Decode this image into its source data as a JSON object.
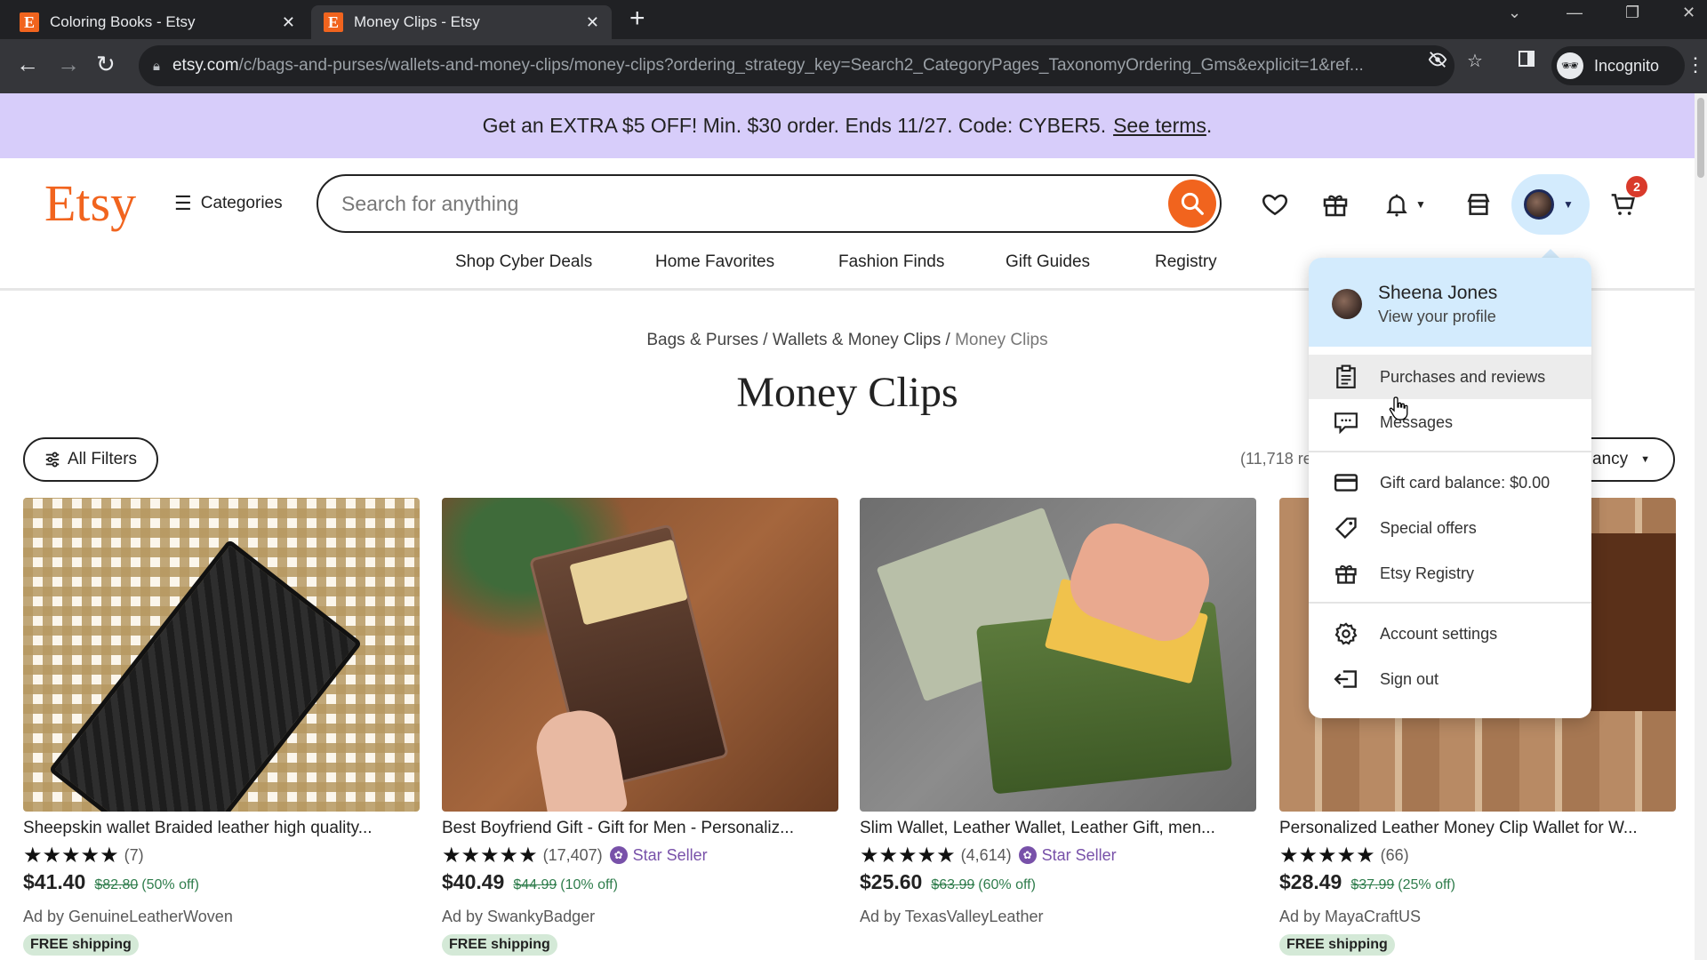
{
  "browser": {
    "tabs": [
      {
        "title": "Coloring Books - Etsy",
        "favicon": "E",
        "active": false
      },
      {
        "title": "Money Clips - Etsy",
        "favicon": "E",
        "active": true
      }
    ],
    "url_host": "etsy.com",
    "url_path": "/c/bags-and-purses/wallets-and-money-clips/money-clips?ordering_strategy_key=Search2_CategoryPages_TaxonomyOrdering_Gms&explicit=1&ref...",
    "profile_label": "Incognito"
  },
  "promo": {
    "text": "Get an EXTRA $5 OFF! Min. $30 order. Ends 11/27. Code: CYBER5.",
    "link": "See terms",
    "link_suffix": ".",
    "background": "#d7cdfa"
  },
  "header": {
    "logo": "Etsy",
    "categories_label": "Categories",
    "search_placeholder": "Search for anything",
    "cart_count": "2",
    "brand_color": "#f1641e",
    "nav": [
      "Shop Cyber Deals",
      "Home Favorites",
      "Fashion Finds",
      "Gift Guides",
      "Registry"
    ]
  },
  "page": {
    "breadcrumb": [
      "Bags & Purses",
      "Wallets & Money Clips",
      "Money Clips"
    ],
    "breadcrumb_sep": " / ",
    "title": "Money Clips",
    "all_filters_label": "All Filters",
    "results_count": "(11,718 re",
    "sort_label": "ancy"
  },
  "products": [
    {
      "title": "Sheepskin wallet Braided leather high quality...",
      "stars": "★★★★★",
      "reviews": "(7)",
      "star_seller": null,
      "price": "$41.40",
      "original_price": "$82.80",
      "discount": "(50% off)",
      "ad_by": "Ad by GenuineLeatherWoven",
      "free_shipping": "FREE shipping"
    },
    {
      "title": "Best Boyfriend Gift - Gift for Men - Personaliz...",
      "stars": "★★★★★",
      "reviews": "(17,407)",
      "star_seller": "Star Seller",
      "price": "$40.49",
      "original_price": "$44.99",
      "discount": "(10% off)",
      "ad_by": "Ad by SwankyBadger",
      "free_shipping": "FREE shipping"
    },
    {
      "title": "Slim Wallet, Leather Wallet, Leather Gift, men...",
      "stars": "★★★★★",
      "reviews": "(4,614)",
      "star_seller": "Star Seller",
      "price": "$25.60",
      "original_price": "$63.99",
      "discount": "(60% off)",
      "ad_by": "Ad by TexasValleyLeather",
      "free_shipping": null
    },
    {
      "title": "Personalized Leather Money Clip Wallet for W...",
      "stars": "★★★★★",
      "reviews": "(66)",
      "star_seller": null,
      "price": "$28.49",
      "original_price": "$37.99",
      "discount": "(25% off)",
      "ad_by": "Ad by MayaCraftUS",
      "free_shipping": "FREE shipping"
    }
  ],
  "account_menu": {
    "name": "Sheena Jones",
    "subtitle": "View your profile",
    "items": [
      {
        "label": "Purchases and reviews",
        "icon": "clipboard-icon",
        "hovered": true
      },
      {
        "label": "Messages",
        "icon": "message-icon"
      },
      {
        "label": "Gift card balance: $0.00",
        "icon": "credit-card-icon"
      },
      {
        "label": "Special offers",
        "icon": "tag-icon"
      },
      {
        "label": "Etsy Registry",
        "icon": "gift-icon"
      },
      {
        "label": "Account settings",
        "icon": "gear-icon"
      },
      {
        "label": "Sign out",
        "icon": "sign-out-icon"
      }
    ]
  }
}
